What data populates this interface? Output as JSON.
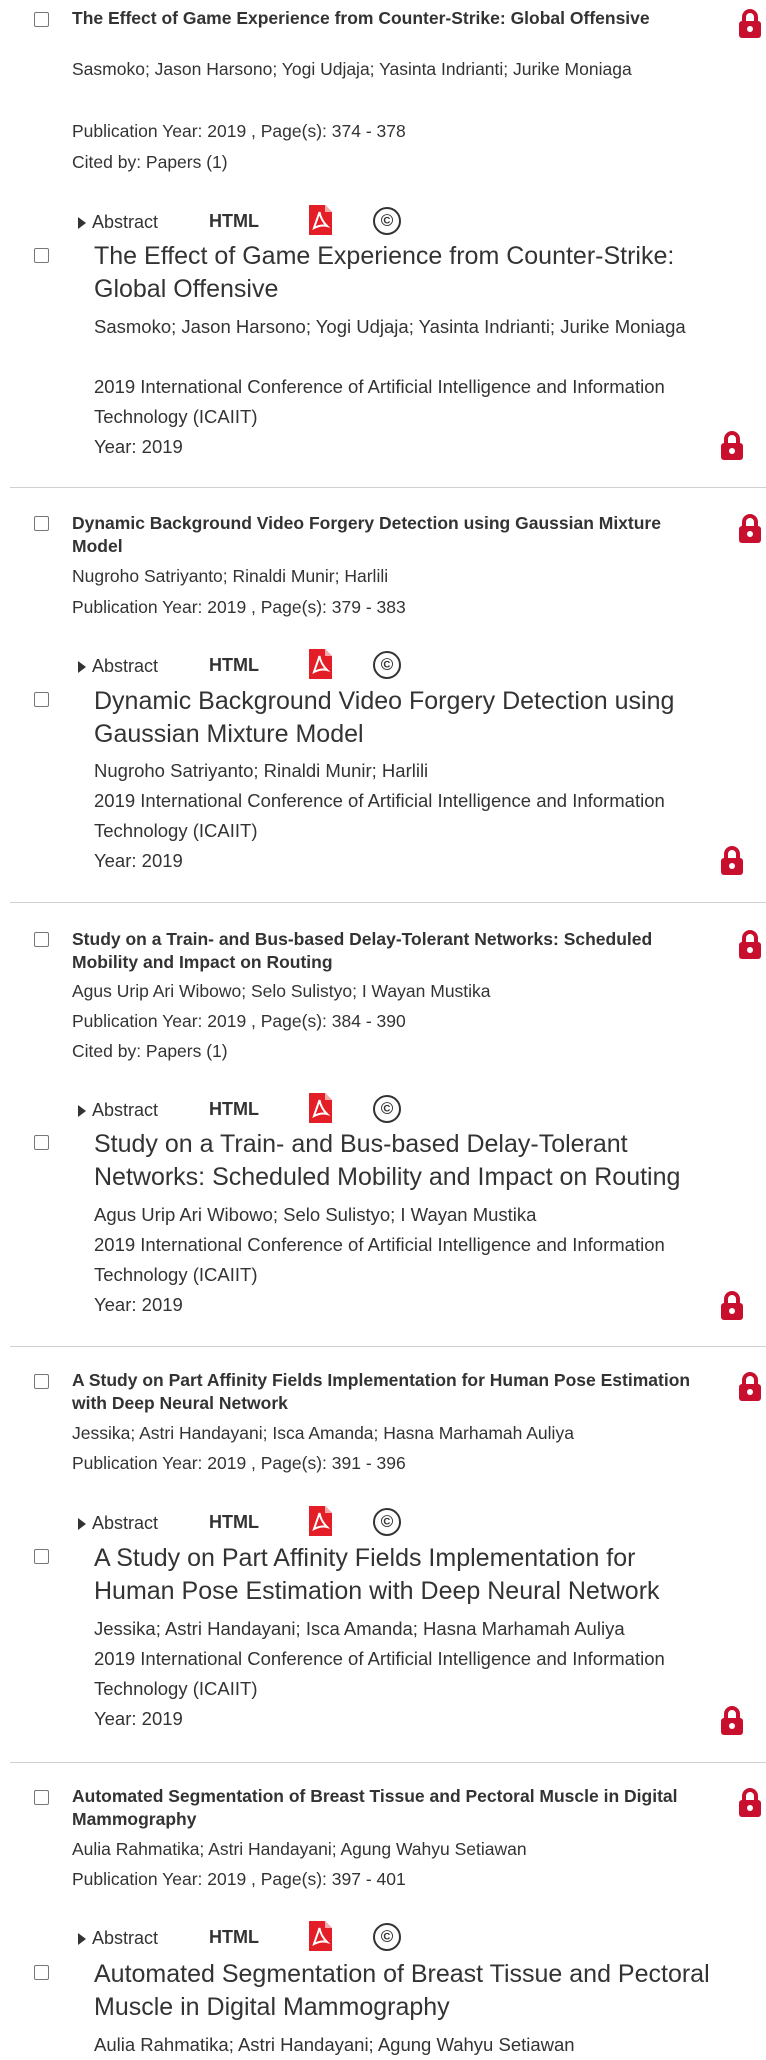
{
  "colors": {
    "lock": "#c8102e",
    "pdf": "#e41e26",
    "text": "#333333",
    "separator": "#d0d0d0"
  },
  "icons": {
    "checkbox": "checkbox-icon",
    "lock": "lock-icon",
    "pdf": "pdf-icon",
    "copyright": "copyright-icon",
    "expand": "triangle-right-icon"
  },
  "labels": {
    "abstract": "Abstract",
    "html": "HTML",
    "copyright_symbol": "©"
  },
  "entries": [
    {
      "title": "The Effect of Game Experience from Counter-Strike: Global Offensive",
      "authors": "Sasmoko; Jason Harsono; Yogi Udjaja; Yasinta Indrianti; Jurike Moniaga",
      "pub": "Publication Year: 2019 , Page(s): 374  -  378",
      "cited": "Cited by: Papers (1)",
      "conf": "2019 International Conference of Artificial Intelligence and Information Technology (ICAIIT)",
      "year": "Year: 2019"
    },
    {
      "title": "Dynamic Background Video Forgery Detection using Gaussian Mixture Model",
      "authors": "Nugroho Satriyanto; Rinaldi Munir; Harlili",
      "pub": "Publication Year: 2019 , Page(s): 379  -  383",
      "cited": "",
      "conf": "2019 International Conference of Artificial Intelligence and Information Technology (ICAIIT)",
      "year": "Year: 2019"
    },
    {
      "title": "Study on a Train- and Bus-based Delay-Tolerant Networks: Scheduled Mobility and Impact on Routing",
      "authors": "Agus Urip Ari Wibowo; Selo Sulistyo; I Wayan Mustika",
      "pub": "Publication Year: 2019 , Page(s): 384  -  390",
      "cited": "Cited by: Papers (1)",
      "conf": "2019 International Conference of Artificial Intelligence and Information Technology (ICAIIT)",
      "year": "Year: 2019"
    },
    {
      "title": "A Study on Part Affinity Fields Implementation for Human Pose Estimation with Deep Neural Network",
      "authors": "Jessika; Astri Handayani; Isca Amanda; Hasna Marhamah Auliya",
      "pub": "Publication Year: 2019 , Page(s): 391  -  396",
      "cited": "",
      "conf": "2019 International Conference of Artificial Intelligence and Information Technology (ICAIIT)",
      "year": "Year: 2019"
    },
    {
      "title": "Automated Segmentation of Breast Tissue and Pectoral Muscle in Digital Mammography",
      "authors": "Aulia Rahmatika; Astri Handayani; Agung Wahyu Setiawan",
      "pub": "Publication Year: 2019 , Page(s): 397  -  401",
      "cited": "",
      "conf": "",
      "year": ""
    }
  ]
}
